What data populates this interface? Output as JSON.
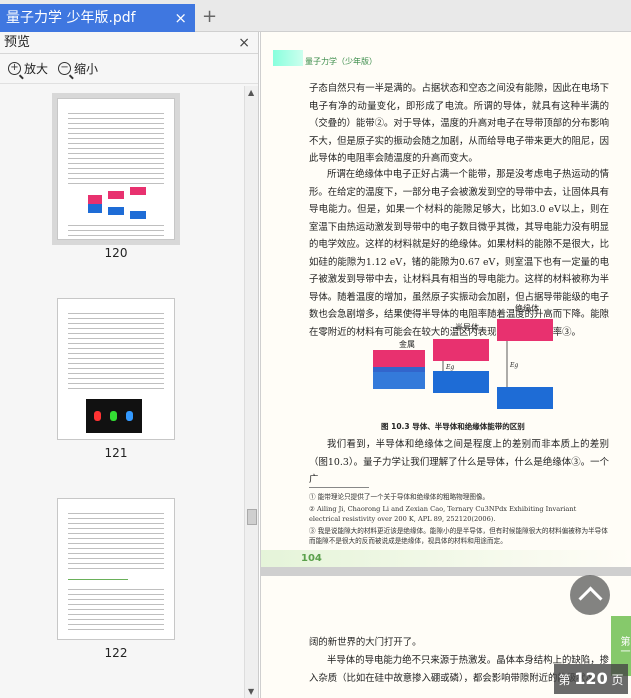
{
  "tab": {
    "title": "量子力学 少年版.pdf",
    "close": "×",
    "add": "+"
  },
  "panel": {
    "title": "预览",
    "close": "×",
    "zoom_in": "放大",
    "zoom_out": "缩小"
  },
  "thumbnails": [
    {
      "page": "120"
    },
    {
      "page": "121"
    },
    {
      "page": "122"
    }
  ],
  "page": {
    "header": "量子力学（少年版）",
    "p1": "子态自然只有一半是满的。占据状态和空态之间没有能隙，因此在电场下电子有净的动量变化，即形成了电流。所谓的导体，就具有这种半满的（交叠的）能带②。对于导体，温度的升高对电子在导带顶部的分布影响不大，但是原子实的振动会随之加剧，从而给导电子带来更大的阻尼，因此导体的电阻率会随温度的升高而变大。",
    "p2": "所谓在绝缘体中电子正好占满一个能带，那是没考虑电子热运动的情形。在给定的温度下，一部分电子会被激发到空的导带中去，让固体具有导电能力。但是，如果一个材料的能隙足够大，比如3.0 eV以上，则在室温下由热运动激发到导带中的电子数目微乎其微，其导电能力没有明显的电学效应。这样的材料就是好的绝缘体。如果材料的能隙不是很大，比如硅的能隙为1.12 eV，锗的能隙为0.67 eV，则室温下也有一定量的电子被激发到导带中去，让材料具有相当的导电能力。这样的材料被称为半导体。随着温度的增加，虽然原子实振动会加剧，但占据导带能级的电子数也会急剧增多，结果使得半导体的电阻率随着温度的升高而下降。能隙在零附近的材料有可能会在较大的温区内表现出恒定的电阻率③。",
    "fig": {
      "metal": "金属",
      "semi": "半导体",
      "insul": "绝缘体",
      "eg": "Eg",
      "caption": "图 10.3  导体、半导体和绝缘体能带的区别"
    },
    "p3": "我们看到，半导体和绝缘体之间是程度上的差别而非本质上的差别（图10.3）。量子力学让我们理解了什么是导体，什么是绝缘体③。一个广",
    "fn1": "①  能带理论只提供了一个关于导体和绝缘体的粗略物理图像。",
    "fn2": "②  Ailing Ji, Chaorong Li and Zexian Cao, Ternary Cu3NPdx Exhibiting Invariant electrical resistivity over 200 K, APL 89, 252120(2006).",
    "fn3": "③  我是说能隙大的材料更近该是绝缘体。能隙小的是半导体，但有时候能隙很大的材料偏被称为半导体而能隙不是很大的反而被说成是绝缘体，视具体的材料和用途而定。",
    "pagenum": "104",
    "p4": "阔的新世界的大门打开了。",
    "p5": "半导体的导电能力绝不只来源于热激发。晶体本身结构上的缺陷，掺入杂质（比如在硅中故意掺入硼或磷），都会影响带隙附近的能级状况",
    "sidetab": "第一"
  },
  "badge": {
    "prefix": "第",
    "num": "120",
    "suffix": "页"
  },
  "colors": {
    "accent": "#3f77e0",
    "band_red": "#e8316f",
    "band_blue": "#1e6cd6"
  }
}
